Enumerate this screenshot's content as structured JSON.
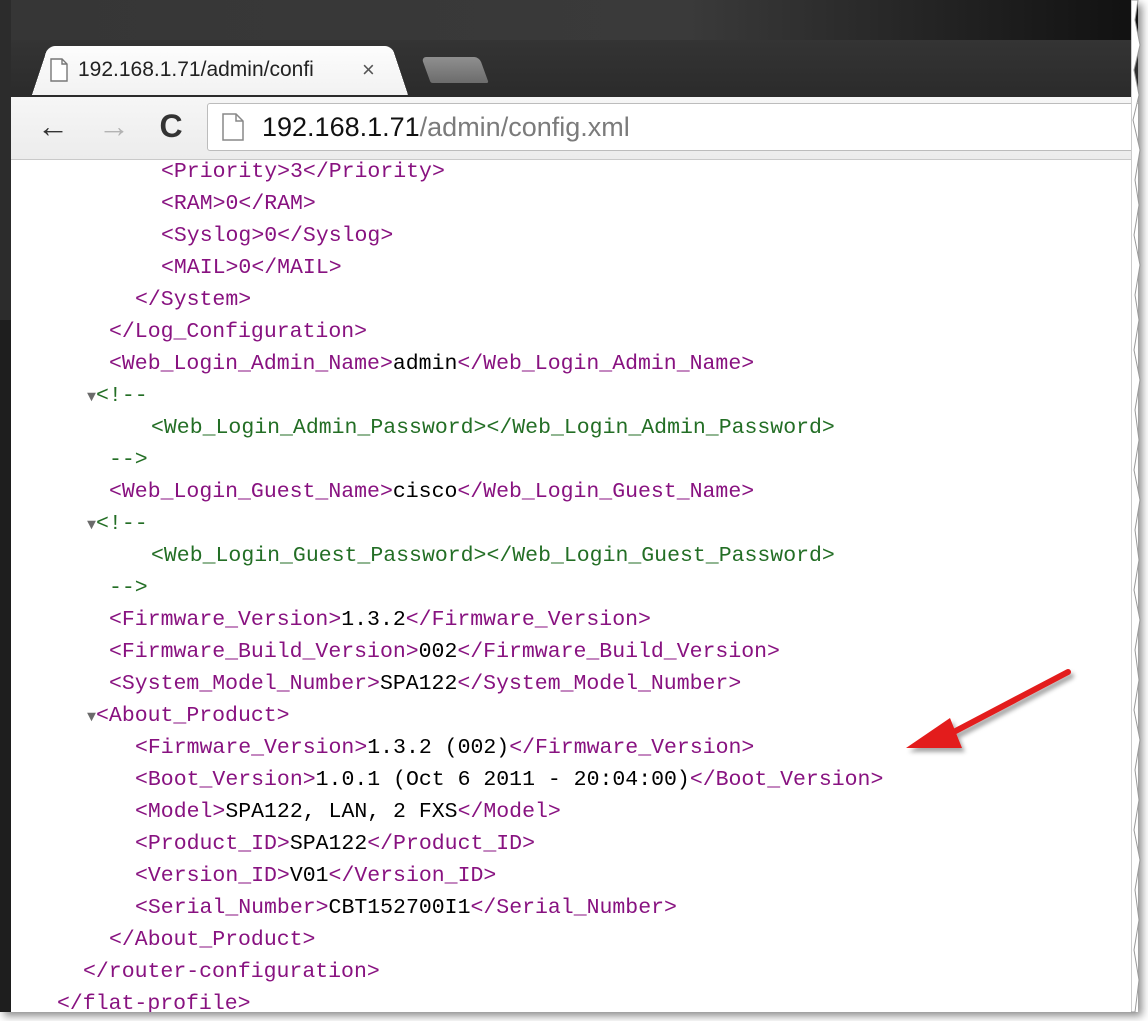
{
  "tab": {
    "title": "192.168.1.71/admin/confi",
    "close": "×"
  },
  "toolbar": {
    "back": "←",
    "forward": "→",
    "reload": "C",
    "url_host": "192.168.1.71",
    "url_path": "/admin/config.xml"
  },
  "xml": {
    "lines": [
      "<Priority>3</Priority>",
      "<RAM>0</RAM>",
      "<Syslog>0</Syslog>",
      "<MAIL>0</MAIL>",
      "</System>",
      "</Log_Configuration>",
      "<Web_Login_Admin_Name>",
      "admin",
      "</Web_Login_Admin_Name>",
      "<!--",
      "<Web_Login_Admin_Password></Web_Login_Admin_Password>",
      "-->",
      "<Web_Login_Guest_Name>",
      "cisco",
      "</Web_Login_Guest_Name>",
      "<!--",
      "<Web_Login_Guest_Password></Web_Login_Guest_Password>",
      "-->",
      "<Firmware_Version>",
      "1.3.2",
      "</Firmware_Version>",
      "<Firmware_Build_Version>",
      "002",
      "</Firmware_Build_Version>",
      "<System_Model_Number>",
      "SPA122",
      "</System_Model_Number>",
      "<About_Product>",
      "<Firmware_Version>",
      "1.3.2 (002)",
      "</Firmware_Version>",
      "<Boot_Version>",
      "1.0.1 (Oct 6 2011 - 20:04:00)",
      "</Boot_Version>",
      "<Model>",
      "SPA122, LAN, 2 FXS",
      "</Model>",
      "<Product_ID>",
      "SPA122",
      "</Product_ID>",
      "<Version_ID>",
      "V01",
      "</Version_ID>",
      "<Serial_Number>",
      "CBT152700I1",
      "</Serial_Number>",
      "</About_Product>",
      "</router-configuration>",
      "</flat-profile>"
    ]
  },
  "colors": {
    "tag": "#881280",
    "comment": "#236e25",
    "value": "#000000",
    "annotation_arrow": "#e31b1b"
  }
}
